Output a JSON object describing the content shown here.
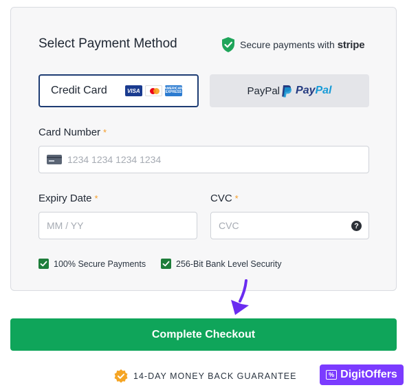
{
  "panel": {
    "title": "Select Payment Method",
    "secure_text": "Secure payments with",
    "secure_brand": "stripe"
  },
  "methods": {
    "credit_card_label": "Credit Card",
    "card_logos": [
      "VISA",
      "mastercard",
      "AMERICAN EXPRESS"
    ],
    "paypal_label": "PayPal",
    "paypal_logo_part1": "Pay",
    "paypal_logo_part2": "Pal"
  },
  "fields": {
    "card_number": {
      "label": "Card Number",
      "required_mark": "*",
      "placeholder": "1234 1234 1234 1234"
    },
    "expiry": {
      "label": "Expiry Date",
      "required_mark": "*",
      "placeholder": "MM / YY"
    },
    "cvc": {
      "label": "CVC",
      "required_mark": "*",
      "placeholder": "CVC",
      "help": "?"
    }
  },
  "assurances": [
    "100% Secure Payments",
    "256-Bit Bank Level Security"
  ],
  "checkout_button": "Complete Checkout",
  "guarantee": "14-DAY MONEY BACK GUARANTEE",
  "brand_badge": "DigitOffers",
  "colors": {
    "primary_button": "#0fa55a",
    "selected_border": "#1d3c73",
    "required": "#f59e2a",
    "check": "#1e7d3a",
    "arrow": "#6a2cf0",
    "badge": "#7b3bff"
  }
}
